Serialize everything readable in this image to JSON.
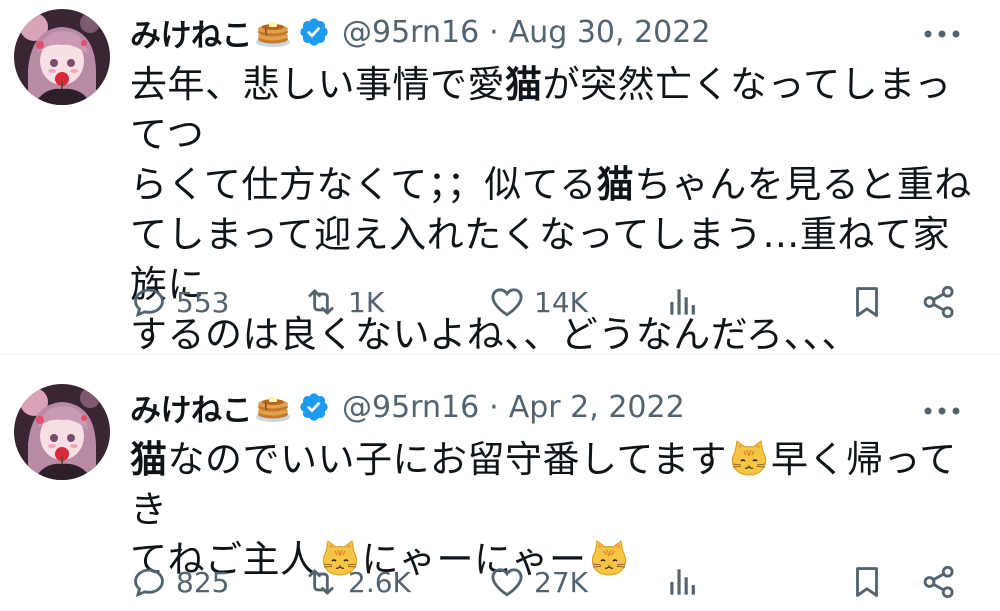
{
  "tweets": [
    {
      "name": "みけねこ",
      "handle": "@95rn16",
      "separator": "·",
      "date": "Aug 30, 2022",
      "text_lines": [
        [
          "去年、悲しい事情で愛",
          "猫",
          "が突然亡くなってしまってつ"
        ],
        [
          "らくて仕方なくて；；似てる",
          "猫",
          "ちゃんを見ると重ね"
        ],
        [
          "てしまって迎え入れたくなってしまう…重ねて家族に"
        ],
        [
          "するのは良くないよね、、どうなんだろ、、、"
        ]
      ],
      "replies": "553",
      "retweets": "1K",
      "likes": "14K"
    },
    {
      "name": "みけねこ",
      "handle": "@95rn16",
      "separator": "·",
      "date": "Apr 2, 2022",
      "text_parts": {
        "bold_word": "猫",
        "line1_a": "なのでいい子にお留守番してます",
        "line1_b": "早く帰ってき",
        "line2_a": "てねご主人",
        "line2_b": "にゃーにゃー"
      },
      "replies": "825",
      "retweets": "2.6K",
      "likes": "27K"
    }
  ],
  "colors": {
    "text": "#0f1419",
    "secondary": "#536471",
    "verified": "#1d9bf0",
    "divider": "#eff3f4"
  },
  "icons": [
    "pancake-icon",
    "verified-badge-icon",
    "more-icon",
    "reply-icon",
    "retweet-icon",
    "like-icon",
    "views-icon",
    "bookmark-icon",
    "share-icon",
    "cat-face-emoji"
  ]
}
